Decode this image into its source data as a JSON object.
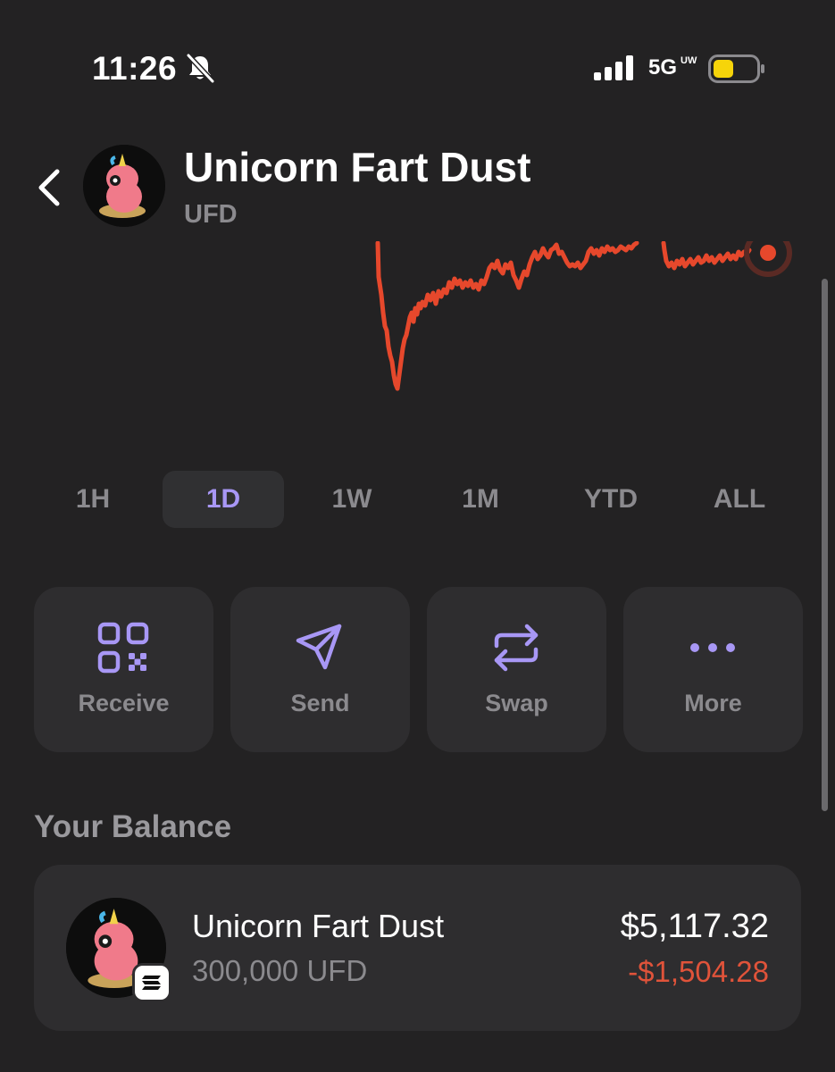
{
  "status_bar": {
    "time": "11:26",
    "network": "5G",
    "network_sub": "UW",
    "icons": [
      "bell-off-icon",
      "signal-icon",
      "battery-icon"
    ]
  },
  "header": {
    "back_icon": "chevron-left-icon",
    "token_name": "Unicorn Fart Dust",
    "token_symbol": "UFD"
  },
  "chart": {
    "type": "line",
    "line_color": "#e6482c",
    "marker_icon": "current-price-dot"
  },
  "range_tabs": [
    {
      "label": "1H",
      "active": false
    },
    {
      "label": "1D",
      "active": true
    },
    {
      "label": "1W",
      "active": false
    },
    {
      "label": "1M",
      "active": false
    },
    {
      "label": "YTD",
      "active": false
    },
    {
      "label": "ALL",
      "active": false
    }
  ],
  "actions": [
    {
      "label": "Receive",
      "icon": "qr-code-icon"
    },
    {
      "label": "Send",
      "icon": "send-icon"
    },
    {
      "label": "Swap",
      "icon": "swap-icon"
    },
    {
      "label": "More",
      "icon": "more-icon"
    }
  ],
  "balance": {
    "section_title": "Your Balance",
    "token_name": "Unicorn Fart Dust",
    "amount": "300,000 UFD",
    "value": "$5,117.32",
    "change": "-$1,504.28",
    "change_color": "#e0533a",
    "chain_icon": "solana-icon"
  },
  "colors": {
    "background": "#232223",
    "card": "#2e2d2f",
    "accent": "#a897f5",
    "negative": "#e0533a"
  }
}
